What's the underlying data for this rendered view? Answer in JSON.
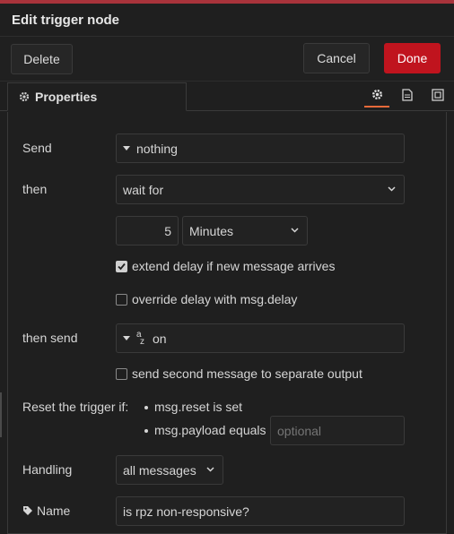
{
  "header": {
    "title": "Edit trigger node"
  },
  "buttons": {
    "delete": "Delete",
    "cancel": "Cancel",
    "done": "Done"
  },
  "tabs": {
    "properties": "Properties"
  },
  "form": {
    "send_label": "Send",
    "send_value": "nothing",
    "then_label": "then",
    "then_value": "wait for",
    "duration_value": "5",
    "duration_unit": "Minutes",
    "extend_label": "extend delay if new message arrives",
    "extend_checked": true,
    "override_label": "override delay with msg.delay",
    "override_checked": false,
    "then_send_label": "then send",
    "then_send_type_icon": "az",
    "then_send_value": "on",
    "second_output_label": "send second message to separate output",
    "second_output_checked": false,
    "reset_label": "Reset the trigger if:",
    "reset_item1": "msg.reset is set",
    "reset_item2": "msg.payload equals",
    "reset_placeholder": "optional",
    "handling_label": "Handling",
    "handling_value": "all messages",
    "name_label": "Name",
    "name_value": "is rpz non-responsive?"
  },
  "colors": {
    "accent": "#c0141e",
    "tab_highlight": "#e86a3a"
  }
}
